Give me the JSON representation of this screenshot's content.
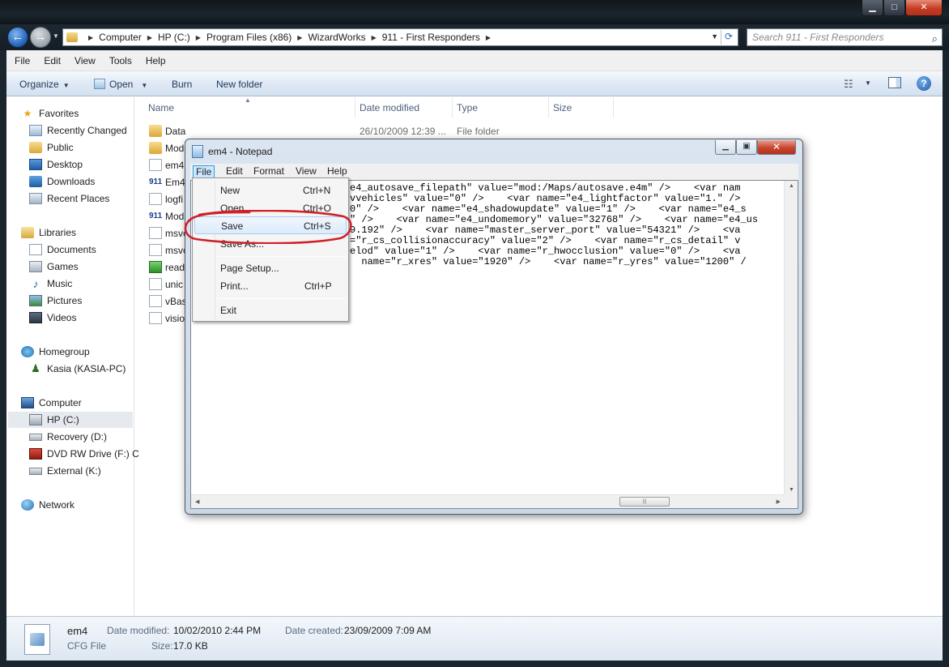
{
  "explorer": {
    "breadcrumbs": [
      "Computer",
      "HP (C:)",
      "Program Files (x86)",
      "WizardWorks",
      "911 - First Responders"
    ],
    "search_placeholder": "Search 911 - First Responders",
    "menu": [
      "File",
      "Edit",
      "View",
      "Tools",
      "Help"
    ],
    "toolbar": {
      "organize": "Organize",
      "open": "Open",
      "burn": "Burn",
      "new_folder": "New folder"
    },
    "nav": {
      "favorites": "Favorites",
      "recently_changed": "Recently Changed",
      "public": "Public",
      "desktop": "Desktop",
      "downloads": "Downloads",
      "recent_places": "Recent Places",
      "libraries": "Libraries",
      "documents": "Documents",
      "games": "Games",
      "music": "Music",
      "pictures": "Pictures",
      "videos": "Videos",
      "homegroup": "Homegroup",
      "kasia": "Kasia (KASIA-PC)",
      "computer": "Computer",
      "hp": "HP (C:)",
      "recovery": "Recovery (D:)",
      "dvd": "DVD RW Drive (F:) C",
      "external": "External (K:)",
      "network": "Network"
    },
    "columns": {
      "name": "Name",
      "date": "Date modified",
      "type": "Type",
      "size": "Size"
    },
    "files": [
      {
        "name": "Data",
        "date": "26/10/2009 12:39 ...",
        "type": "File folder"
      },
      {
        "name": "Mod",
        "date": "",
        "type": ""
      },
      {
        "name": "em4",
        "date": "",
        "type": ""
      },
      {
        "name": "Em4",
        "date": "",
        "type": ""
      },
      {
        "name": "logfi",
        "date": "",
        "type": ""
      },
      {
        "name": "Mod",
        "date": "",
        "type": ""
      },
      {
        "name": "msvc",
        "date": "",
        "type": ""
      },
      {
        "name": "msvc",
        "date": "",
        "type": ""
      },
      {
        "name": "read",
        "date": "",
        "type": ""
      },
      {
        "name": "unic",
        "date": "",
        "type": ""
      },
      {
        "name": "vBas",
        "date": "",
        "type": ""
      },
      {
        "name": "visio",
        "date": "",
        "type": ""
      }
    ],
    "details": {
      "filename": "em4",
      "filetype": "CFG File",
      "date_modified_label": "Date modified:",
      "date_modified": "10/02/2010 2:44 PM",
      "date_created_label": "Date created:",
      "date_created": "23/09/2009 7:09 AM",
      "size_label": "Size:",
      "size": "17.0 KB"
    }
  },
  "notepad": {
    "title": "em4 - Notepad",
    "menu": [
      "File",
      "Edit",
      "Format",
      "View",
      "Help"
    ],
    "lines": [
      "e4_autosave_filepath\" value=\"mod:/Maps/autosave.e4m\" />    <var nam",
      "vvehicles\" value=\"0\" />    <var name=\"e4_lightfactor\" value=\"1.\" />",
      "0\" />    <var name=\"e4_shadowupdate\" value=\"1\" />    <var name=\"e4_s",
      "\" />    <var name=\"e4_undomemory\" value=\"32768\" />    <var name=\"e4_us",
      "9.192\" />    <var name=\"master_server_port\" value=\"54321\" />    <va",
      "=\"r_cs_collisionaccuracy\" value=\"2\" />    <var name=\"r_cs_detail\" v",
      "elod\" value=\"1\" />    <var name=\"r_hwocclusion\" value=\"0\" />    <va",
      "  name=\"r_xres\" value=\"1920\" />    <var name=\"r_yres\" value=\"1200\" /"
    ]
  },
  "file_menu": {
    "new": "New",
    "new_sc": "Ctrl+N",
    "open": "Open...",
    "open_sc": "Ctrl+O",
    "save": "Save",
    "save_sc": "Ctrl+S",
    "save_as": "Save As...",
    "page_setup": "Page Setup...",
    "print": "Print...",
    "print_sc": "Ctrl+P",
    "exit": "Exit"
  },
  "annotation_color": "#d0202a"
}
